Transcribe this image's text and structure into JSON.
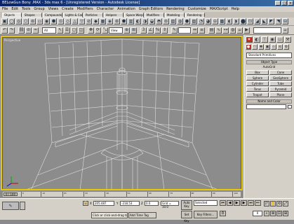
{
  "app": {
    "title": "BELowGun Bony .MAX - 3ds max 6 - [Unregistered Version - Autodesk License]",
    "window_controls": [
      "_",
      "□",
      "×"
    ]
  },
  "menu": [
    "File",
    "Edit",
    "Tools",
    "Group",
    "Views",
    "Create",
    "Modifiers",
    "Character",
    "Animation",
    "Graph Editors",
    "Rendering",
    "Customize",
    "MAXScript",
    "Help"
  ],
  "tabs": [
    {
      "label": "Objects",
      "active": true
    },
    {
      "label": "Shapes",
      "active": false
    },
    {
      "label": "Compounds",
      "active": false
    },
    {
      "label": "Lights & Cameras",
      "active": false
    },
    {
      "label": "Particles",
      "active": false
    },
    {
      "label": "Helpers",
      "active": false
    },
    {
      "label": "Space Warps",
      "active": false
    },
    {
      "label": "Modifiers",
      "active": false
    },
    {
      "label": "Modeling",
      "active": false
    },
    {
      "label": "Rendering",
      "active": false
    }
  ],
  "toolbar": {
    "selection_filter": "All",
    "ref_coord": "View",
    "named_selection": ""
  },
  "viewport": {
    "label": "Perspective"
  },
  "command_panel": {
    "tabs": [
      {
        "icon": "create-icon",
        "glyph": "✦",
        "active": true
      },
      {
        "icon": "modify-icon",
        "glyph": "◐",
        "active": false
      },
      {
        "icon": "hierarchy-icon",
        "glyph": "⊤",
        "active": false
      },
      {
        "icon": "motion-icon",
        "glyph": "◉",
        "active": false
      },
      {
        "icon": "display-icon",
        "glyph": "▭",
        "active": false
      },
      {
        "icon": "utilities-icon",
        "glyph": "⚒",
        "active": false
      }
    ],
    "category_dropdown": "Standard Primitives",
    "object_type_header": "Object Type",
    "autogrid_label": "AutoGrid",
    "buttons": [
      "Box",
      "Cone",
      "Sphere",
      "GeoSphere",
      "Cylinder",
      "Tube",
      "Torus",
      "Pyramid",
      "Teapot",
      "Plane"
    ],
    "name_color_header": "Name and Color"
  },
  "timeline": {
    "slider_label": "0 / 100",
    "ticks": [
      "0",
      "10",
      "20",
      "30",
      "40",
      "50",
      "60",
      "70",
      "80",
      "90",
      "100"
    ]
  },
  "status": {
    "x_label": "X",
    "x_value": "205.487",
    "y_label": "Y",
    "y_value": "-218.53",
    "z_label": "Z",
    "z_value": "0.0",
    "grid": "Grid = 10.0",
    "prompt": "Click or click-and-drag to select objects",
    "add_time_tag": "Add Time Tag",
    "auto_key": "Auto Key",
    "set_key": "Set Key",
    "selected": "Selected",
    "key_filters": "Key Filters...",
    "frame": "0"
  }
}
